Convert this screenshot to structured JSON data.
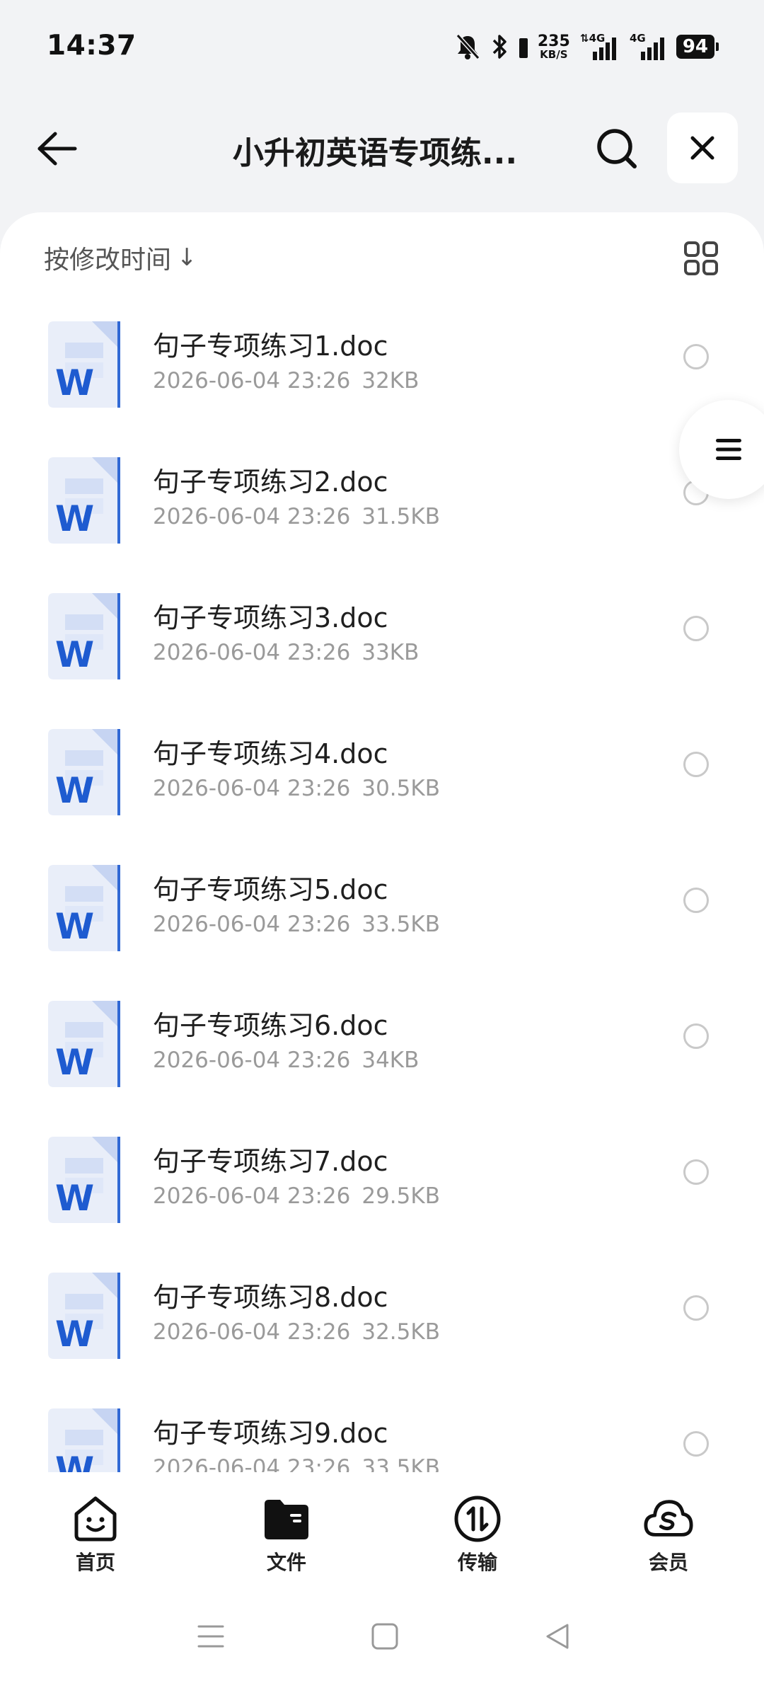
{
  "status_bar": {
    "time": "14:37",
    "net_speed_value": "235",
    "net_speed_unit": "KB/S",
    "signal_1_label": "4G",
    "signal_2_label": "4G",
    "battery": "94",
    "icons": [
      "bell-muted-icon",
      "bluetooth-icon",
      "signal-icon",
      "signal-icon"
    ]
  },
  "header": {
    "title": "小升初英语专项练...",
    "back_icon": "arrow-left-icon",
    "search_icon": "search-icon",
    "close_icon": "close-icon"
  },
  "toolbar": {
    "sort_label": "按修改时间",
    "sort_arrow": "↓",
    "view_toggle_icon": "grid-view-icon"
  },
  "files": [
    {
      "name": "句子专项练习1.doc",
      "date": "2026-06-04 23:26",
      "size": "32KB"
    },
    {
      "name": "句子专项练习2.doc",
      "date": "2026-06-04 23:26",
      "size": "31.5KB"
    },
    {
      "name": "句子专项练习3.doc",
      "date": "2026-06-04 23:26",
      "size": "33KB"
    },
    {
      "name": "句子专项练习4.doc",
      "date": "2026-06-04 23:26",
      "size": "30.5KB"
    },
    {
      "name": "句子专项练习5.doc",
      "date": "2026-06-04 23:26",
      "size": "33.5KB"
    },
    {
      "name": "句子专项练习6.doc",
      "date": "2026-06-04 23:26",
      "size": "34KB"
    },
    {
      "name": "句子专项练习7.doc",
      "date": "2026-06-04 23:26",
      "size": "29.5KB"
    },
    {
      "name": "句子专项练习8.doc",
      "date": "2026-06-04 23:26",
      "size": "32.5KB"
    },
    {
      "name": "句子专项练习9.doc",
      "date": "2026-06-04 23:26",
      "size": "33.5KB"
    }
  ],
  "file_icon_letter": "W",
  "tabs": [
    {
      "label": "首页",
      "icon": "home-face-icon"
    },
    {
      "label": "文件",
      "icon": "folder-icon"
    },
    {
      "label": "传输",
      "icon": "transfer-icon"
    },
    {
      "label": "会员",
      "icon": "cloud-member-icon"
    }
  ],
  "colors": {
    "word_blue": "#1e5bd0",
    "text_primary": "#1f1f1f",
    "text_secondary": "#9a9a9a",
    "page_bg": "#f2f3f5"
  }
}
